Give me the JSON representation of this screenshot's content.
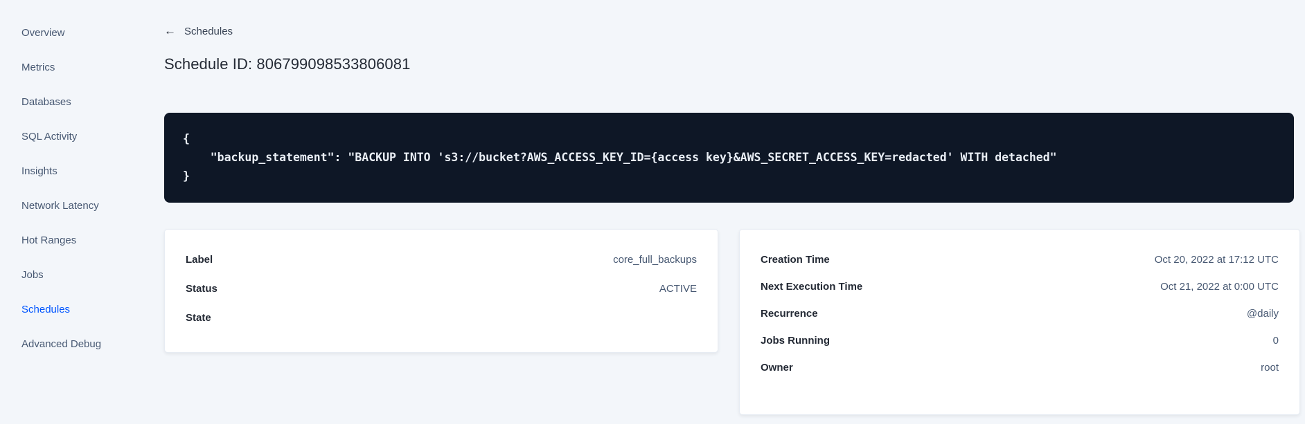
{
  "sidebar": {
    "items": [
      {
        "label": "Overview",
        "active": false
      },
      {
        "label": "Metrics",
        "active": false
      },
      {
        "label": "Databases",
        "active": false
      },
      {
        "label": "SQL Activity",
        "active": false
      },
      {
        "label": "Insights",
        "active": false
      },
      {
        "label": "Network Latency",
        "active": false
      },
      {
        "label": "Hot Ranges",
        "active": false
      },
      {
        "label": "Jobs",
        "active": false
      },
      {
        "label": "Schedules",
        "active": true
      },
      {
        "label": "Advanced Debug",
        "active": false
      }
    ]
  },
  "header": {
    "back_icon": "←",
    "back_label": "Schedules",
    "title": "Schedule ID: 806799098533806081"
  },
  "code_block": {
    "text": "{\n    \"backup_statement\": \"BACKUP INTO 's3://bucket?AWS_ACCESS_KEY_ID={access key}&AWS_SECRET_ACCESS_KEY=redacted' WITH detached\"\n}"
  },
  "details_card": {
    "rows": [
      {
        "label": "Label",
        "value": "core_full_backups"
      },
      {
        "label": "Status",
        "value": "ACTIVE"
      },
      {
        "label": "State",
        "value": ""
      }
    ]
  },
  "schedule_card": {
    "rows": [
      {
        "label": "Creation Time",
        "value": "Oct 20, 2022 at 17:12 UTC"
      },
      {
        "label": "Next Execution Time",
        "value": "Oct 21, 2022 at 0:00 UTC"
      },
      {
        "label": "Recurrence",
        "value": "@daily"
      },
      {
        "label": "Jobs Running",
        "value": "0"
      },
      {
        "label": "Owner",
        "value": "root"
      }
    ]
  },
  "colors": {
    "page_background": "#f3f6fa",
    "active_link_blue": "#0055ff",
    "code_block_background": "#0e1726",
    "card_background": "#ffffff",
    "heading_text": "#242a35"
  }
}
